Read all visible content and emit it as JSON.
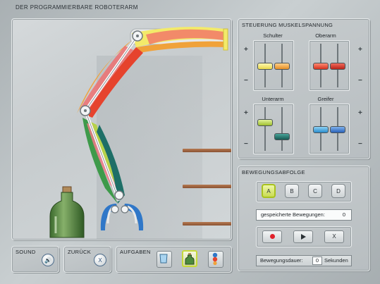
{
  "app_title": "DER PROGRAMMIERBARE ROBOTERARM",
  "control": {
    "title": "STEUERUNG MUSKELSPANNUNG",
    "plus": "+",
    "minus": "−",
    "sliders": [
      {
        "label": "Schulter",
        "thumb_colors": [
          "#f0e86a",
          "#f0a23a"
        ]
      },
      {
        "label": "Oberarm",
        "thumb_colors": [
          "#e3452e",
          "#c82e22"
        ]
      },
      {
        "label": "Unterarm",
        "thumb_colors": [
          "#b6d24a",
          "#1e6f67"
        ]
      },
      {
        "label": "Greifer",
        "thumb_colors": [
          "#3aa0d8",
          "#2a6fc0"
        ]
      }
    ]
  },
  "sequence": {
    "title": "BEWEGUNGSABFOLGE",
    "slots": [
      "A",
      "B",
      "C",
      "D"
    ],
    "active_slot": "A",
    "saved_label": "gespeicherte Bewegungen:",
    "saved_count": "0",
    "record_icon": "record-icon",
    "play_icon": "play-icon",
    "clear_label": "X",
    "duration_label": "Bewegungsdauer:",
    "duration_value": "0",
    "duration_unit": "Sekunden"
  },
  "bottom": {
    "sound_label": "SOUND",
    "back_label": "ZURÜCK",
    "back_button": "X",
    "tasks_label": "AUFGABEN",
    "tasks": [
      "cup-task-icon",
      "bottle-task-icon",
      "balls-task-icon"
    ],
    "active_task": "bottle-task-icon"
  },
  "colors": {
    "shoulder_muscle": "#f3ea6a",
    "upper_arm_muscle": "#e6432d",
    "forearm_muscle": "#3e9a4a",
    "gripper_muscle": "#2f77c8",
    "accent_green": "#b6d24a"
  }
}
